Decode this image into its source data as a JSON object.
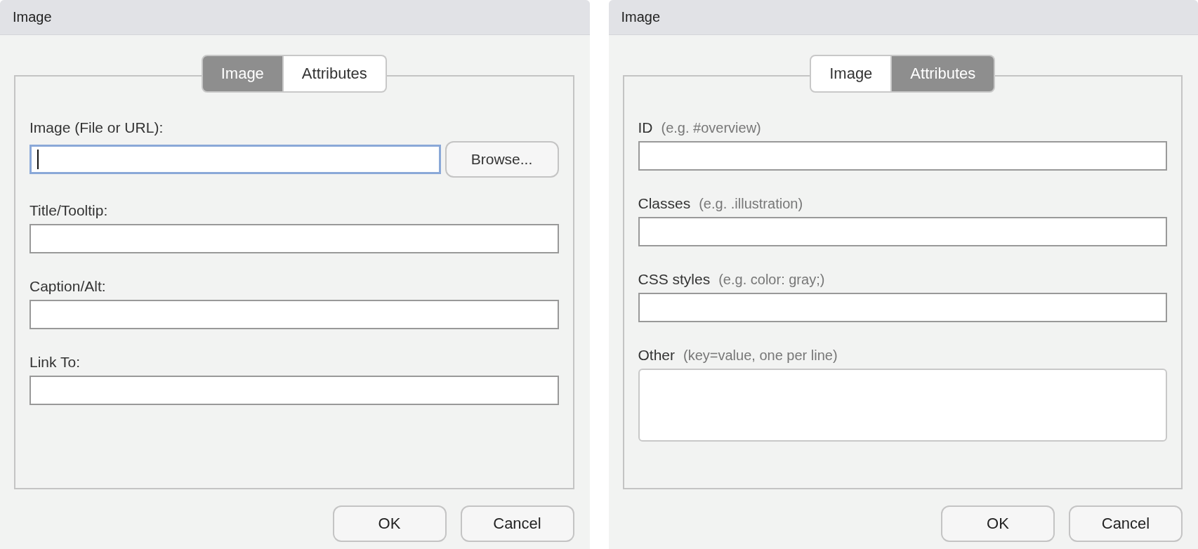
{
  "dialogs": [
    {
      "title": "Image",
      "tabs": [
        {
          "label": "Image",
          "selected": true
        },
        {
          "label": "Attributes",
          "selected": false
        }
      ],
      "fields": [
        {
          "kind": "file",
          "label": "Image (File or URL):",
          "focused": true,
          "button": "Browse..."
        },
        {
          "kind": "text",
          "label": "Title/Tooltip:",
          "focused": false
        },
        {
          "kind": "text",
          "label": "Caption/Alt:",
          "focused": false
        },
        {
          "kind": "text",
          "label": "Link To:",
          "focused": false
        }
      ],
      "buttons": [
        "OK",
        "Cancel"
      ]
    },
    {
      "title": "Image",
      "tabs": [
        {
          "label": "Image",
          "selected": false
        },
        {
          "label": "Attributes",
          "selected": true
        }
      ],
      "fields": [
        {
          "kind": "text",
          "label": "ID",
          "hint": "(e.g. #overview)",
          "focused": false
        },
        {
          "kind": "text",
          "label": "Classes",
          "hint": "(e.g. .illustration)",
          "focused": false
        },
        {
          "kind": "text",
          "label": "CSS styles",
          "hint": "(e.g. color: gray;)",
          "focused": false
        },
        {
          "kind": "textarea",
          "label": "Other",
          "hint": "(key=value, one per line)",
          "focused": false
        }
      ],
      "buttons": [
        "OK",
        "Cancel"
      ]
    }
  ]
}
